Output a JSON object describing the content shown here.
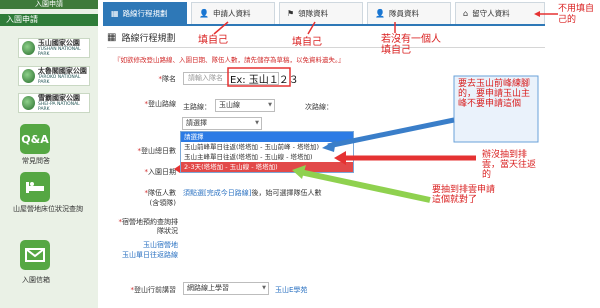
{
  "sidebar": {
    "top_text": "入園申請",
    "heading": "入園申請",
    "parks": [
      {
        "name": "玉山國家公園",
        "name_en": "YUSHAN NATIONAL PARK"
      },
      {
        "name": "太魯閣國家公園",
        "name_en": "TAROKO NATIONAL PARK"
      },
      {
        "name": "雪霸國家公園",
        "name_en": "SHEI-PA NATIONAL PARK"
      }
    ],
    "links": [
      {
        "icon_text": "Q&A",
        "label": "常見問答"
      },
      {
        "icon_text": "",
        "label": "山屋營地床位狀況查詢"
      },
      {
        "icon_text": "",
        "label": "入園信箱"
      }
    ]
  },
  "tabs": [
    {
      "label": "路線行程規劃",
      "icon": "calendar-icon"
    },
    {
      "label": "申請人資料",
      "icon": "person-icon"
    },
    {
      "label": "領隊資料",
      "icon": "flag-icon"
    },
    {
      "label": "隊員資料",
      "icon": "person-icon"
    },
    {
      "label": "留守人資料",
      "icon": "home-icon"
    }
  ],
  "section_title": "路線行程規劃",
  "notice": "『如欲修改登山路線、入園日期、隊伍人數，請先儲存為草稿，以免資料遺失。』",
  "form": {
    "team_name_label": "隊名",
    "team_name_placeholder": "請輸入隊名",
    "team_name_example": "Ex: 玉山１２３",
    "route_label": "登山路線",
    "main_route_label": "主路線：",
    "main_route_value": "玉山線",
    "sub_route_label": "次路線：",
    "route_select_value": "請選擇",
    "options": [
      "請選擇",
      "玉山前峰單日往返(塔塔加 - 玉山前峰 - 塔塔加)",
      "玉山主峰單日往返(塔塔加 - 玉山線 - 塔塔加)",
      "2-3天(塔塔加 - 玉山線 - 塔塔加)"
    ],
    "days_label": "登山總日數",
    "entry_date_label": "入園日期",
    "members_label": "隊伍人數",
    "members_sub": "(含領隊)",
    "members_note_link": "須點選[完成今日路線]",
    "members_note_rest": "後，始可選擇隊伍人數",
    "lodging_label": "宿營地預約查詢排隊狀況",
    "lodging_link1": "玉山宿營地",
    "lodging_link2": "玉山單日往返路線",
    "guide_label": "登山行前講習",
    "guide_select": "網路線上學習",
    "guide_link": "玉山E學苑"
  },
  "annotations": {
    "a1": "填自己",
    "a2": "填自己",
    "a3": "若沒有一個人填自己",
    "a4": "不用填自己的",
    "blue": "要去玉山前峰練腳的，要申請玉山主峰不要申請這個",
    "red": "辦沒抽到排雲，當天往返的",
    "green": "要抽到排雲申請這個就對了"
  }
}
